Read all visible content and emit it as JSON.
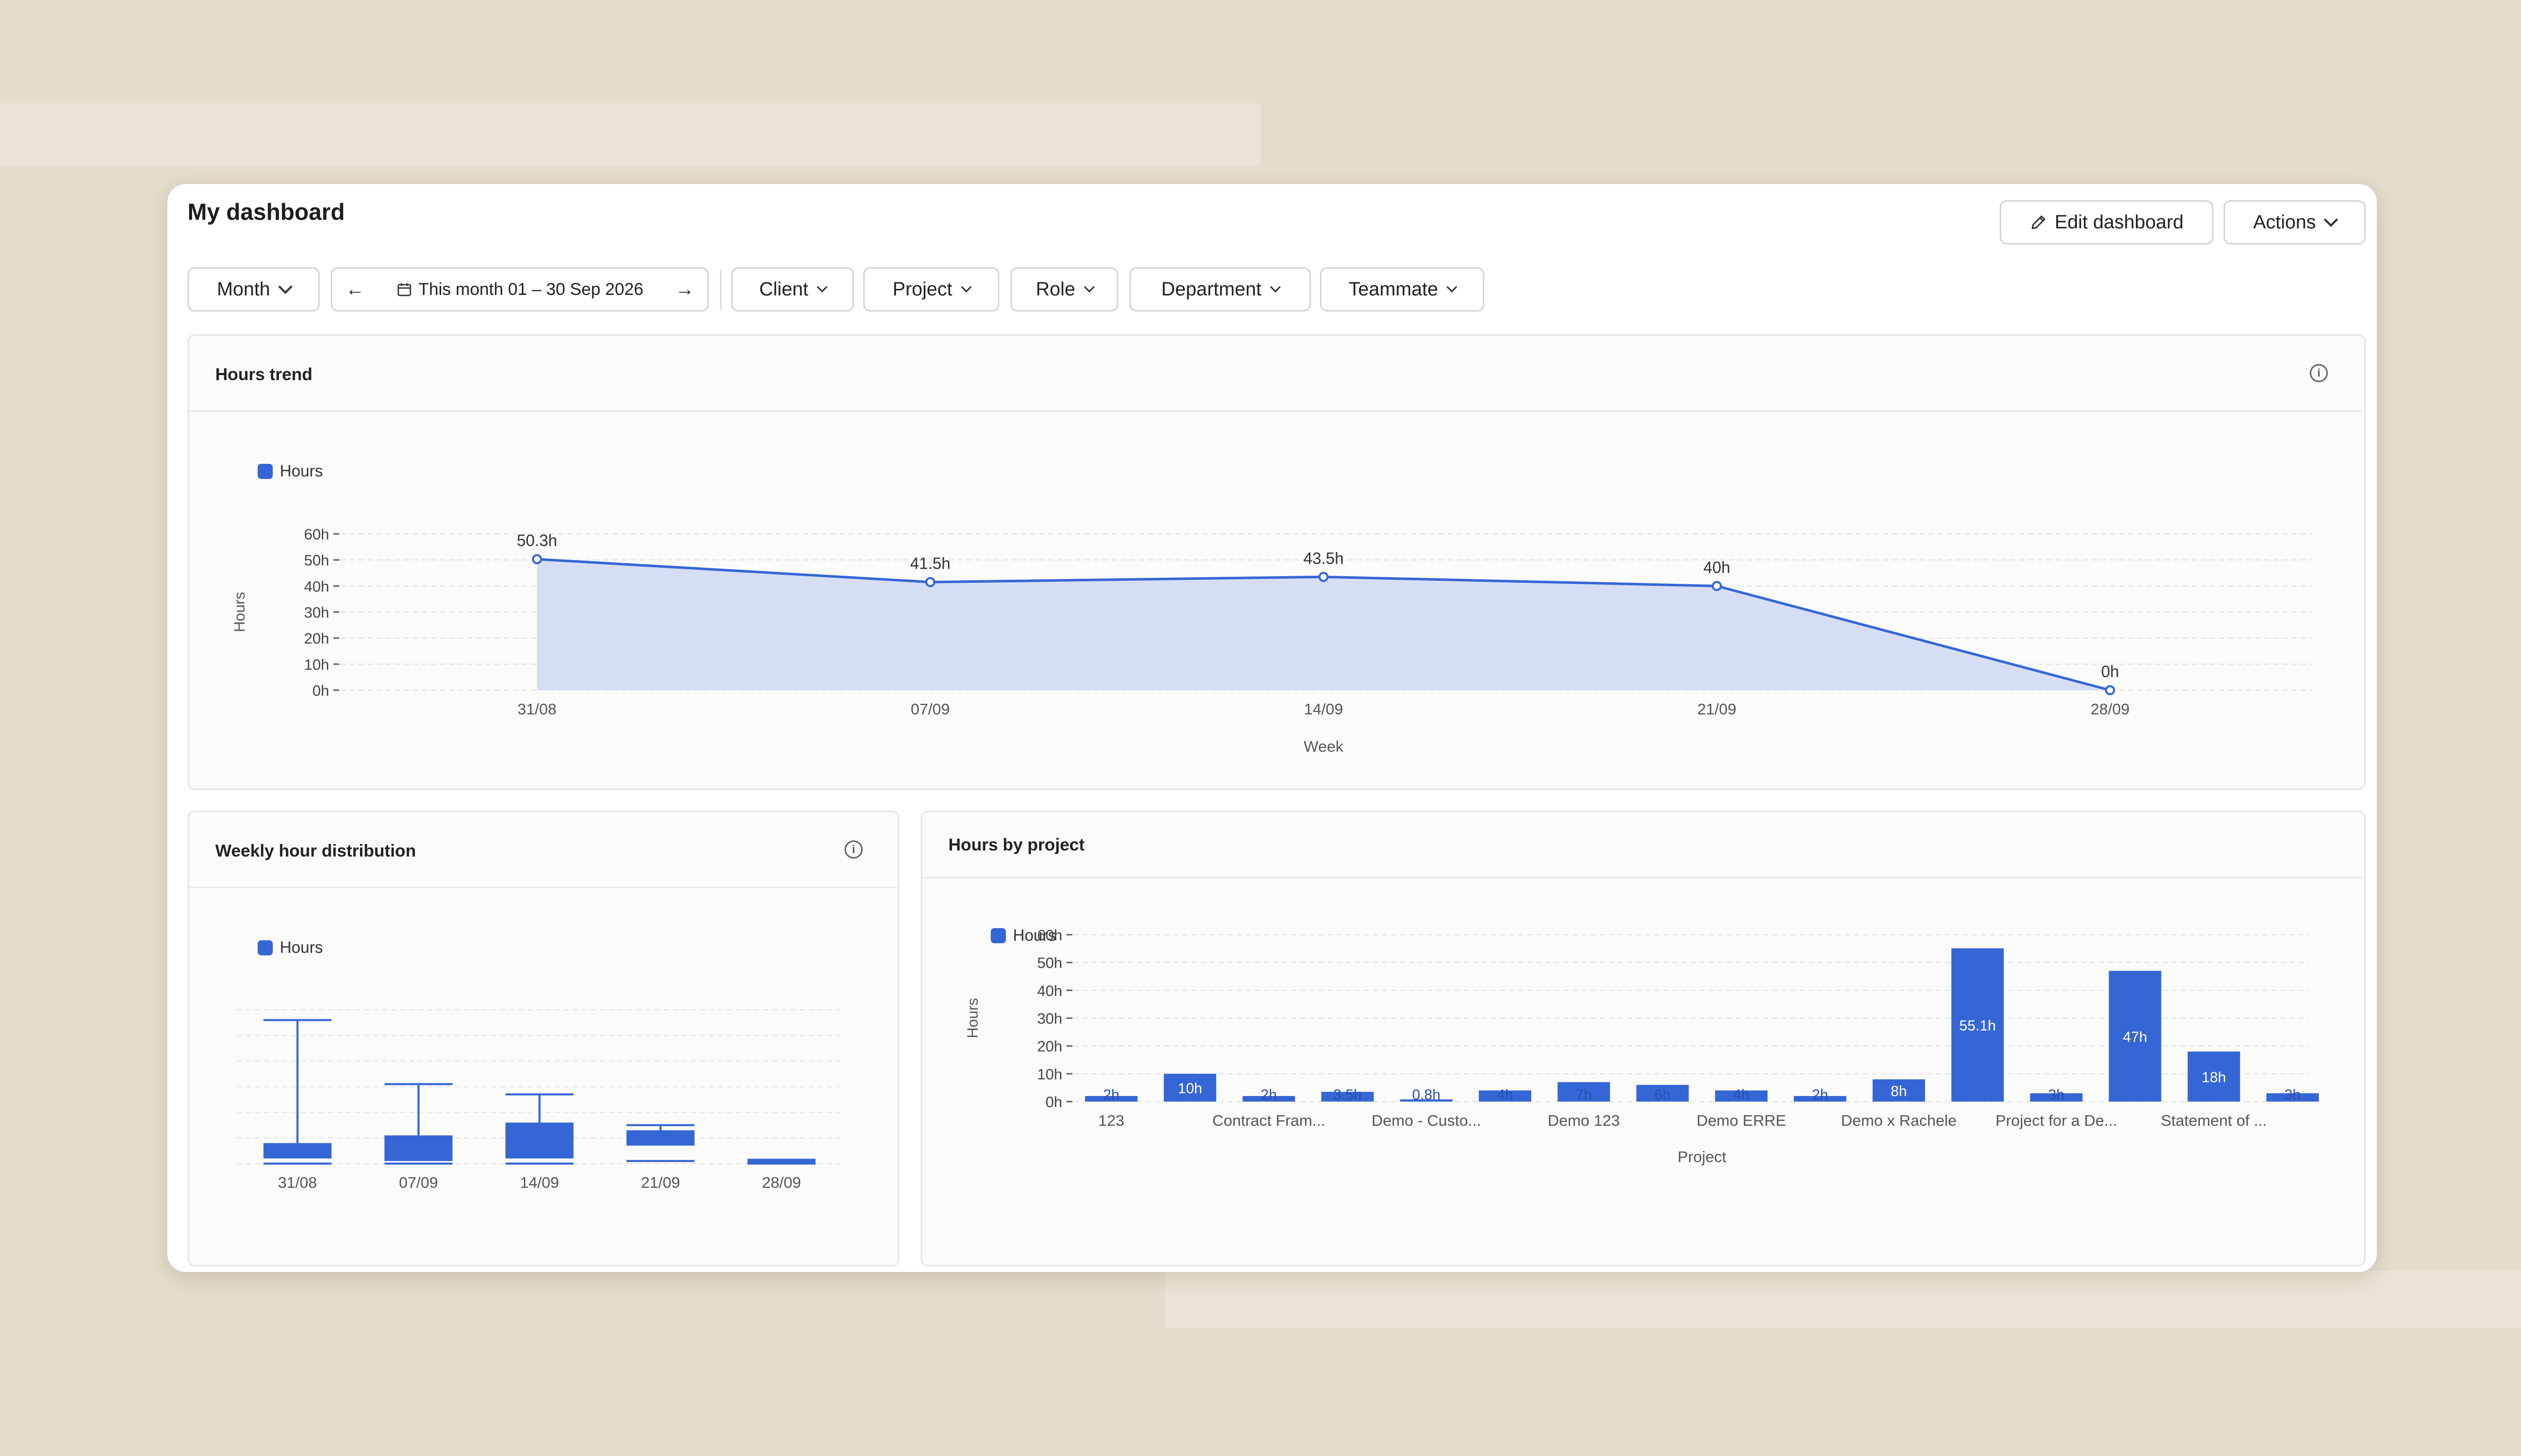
{
  "page": {
    "title": "My dashboard"
  },
  "header": {
    "edit_label": "Edit dashboard",
    "actions_label": "Actions"
  },
  "filters": {
    "period": "Month",
    "range": "This month 01 – 30 Sep 2026",
    "client": "Client",
    "project": "Project",
    "role": "Role",
    "department": "Department",
    "teammate": "Teammate"
  },
  "icons": {
    "edit": "pencil-icon",
    "prev": "arrow-left-icon",
    "next": "arrow-right-icon",
    "calendar": "calendar-icon",
    "info": "info-icon",
    "dropdown": "chevron-down-icon"
  },
  "colors": {
    "accent": "#3566d6",
    "area_fill": "#d6def6",
    "background": "#e4dccd"
  },
  "hours_trend": {
    "title": "Hours trend",
    "info_glyph": "i",
    "chart_data": {
      "type": "area",
      "series": [
        {
          "name": "Hours",
          "values": [
            50.3,
            41.5,
            43.5,
            40,
            0
          ]
        }
      ],
      "categories": [
        "31/08",
        "07/09",
        "14/09",
        "21/09",
        "28/09"
      ],
      "data_labels": [
        "50.3h",
        "41.5h",
        "43.5h",
        "40h",
        "0h"
      ],
      "y_ticks": [
        "60h",
        "50h",
        "40h",
        "30h",
        "20h",
        "10h",
        "0h"
      ],
      "ylim": [
        0,
        60
      ],
      "xlabel": "Week",
      "ylabel": "Hours",
      "legend": "top-left",
      "grid": true
    }
  },
  "weekly_distribution": {
    "title": "Weekly hour distribution",
    "info_glyph": "i",
    "chart_data": {
      "type": "box",
      "series": [
        {
          "name": "Hours"
        }
      ],
      "categories": [
        "31/08",
        "07/09",
        "14/09",
        "21/09",
        "28/09"
      ],
      "boxes": [
        {
          "min": 0,
          "q1": 2,
          "q3": 8,
          "max": 56
        },
        {
          "min": 0,
          "q1": 1,
          "q3": 11,
          "max": 31
        },
        {
          "min": 0,
          "q1": 2,
          "q3": 16,
          "max": 27
        },
        {
          "min": 1,
          "q1": 7,
          "q3": 13,
          "max": 15
        },
        {
          "min": 0,
          "q1": 0,
          "q3": 1.5,
          "max": 1.5
        }
      ],
      "ylim": [
        0,
        60
      ],
      "legend": "top-left",
      "grid": true
    }
  },
  "hours_by_project": {
    "title": "Hours by project",
    "chart_data": {
      "type": "bar",
      "series": [
        {
          "name": "Hours",
          "values": [
            2,
            10,
            2,
            3.5,
            0.8,
            4,
            7,
            6,
            4,
            2,
            8,
            55.1,
            3,
            47,
            18,
            3
          ]
        }
      ],
      "data_labels": [
        "2h",
        "10h",
        "2h",
        "3.5h",
        "0.8h",
        "4h",
        "7h",
        "6h",
        "4h",
        "2h",
        "8h",
        "55.1h",
        "3h",
        "47h",
        "18h",
        "3h"
      ],
      "x_tick_labels": [
        "123",
        "Contract Fram...",
        "Demo - Custo...",
        "Demo 123",
        "Demo ERRE",
        "Demo x Rachele",
        "Project for a De...",
        "Statement of ..."
      ],
      "y_ticks": [
        "60h",
        "50h",
        "40h",
        "30h",
        "20h",
        "10h",
        "0h"
      ],
      "ylim": [
        0,
        60
      ],
      "xlabel": "Project",
      "ylabel": "Hours",
      "legend": "top-left",
      "grid": true
    }
  }
}
